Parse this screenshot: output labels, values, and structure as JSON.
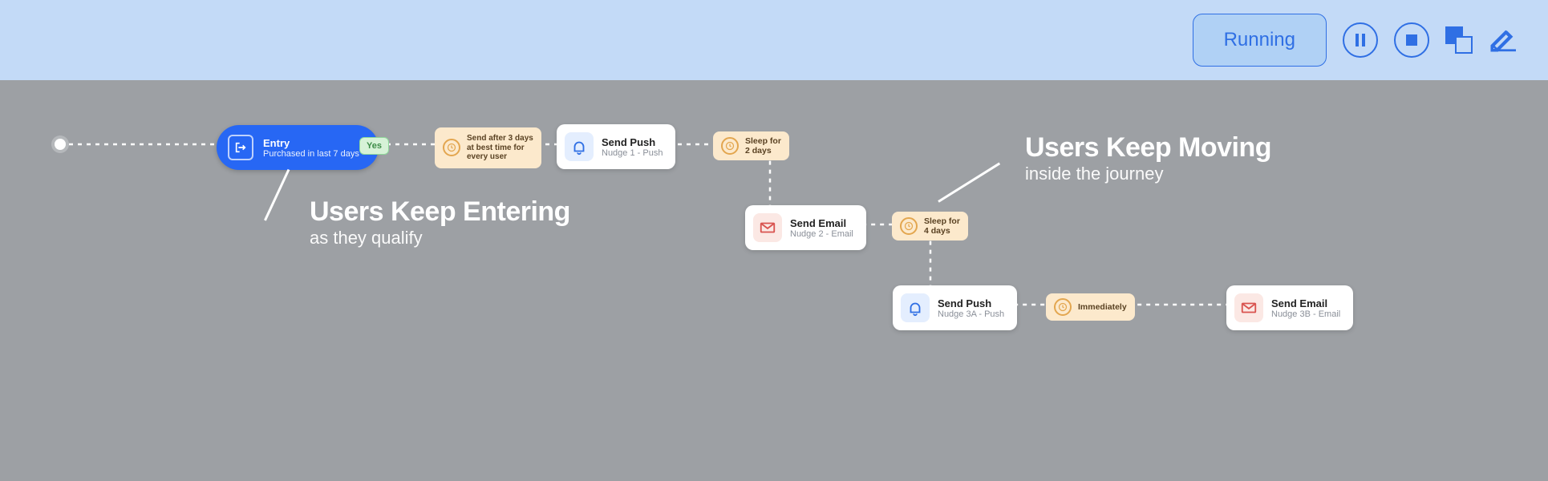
{
  "header": {
    "status": "Running"
  },
  "entry": {
    "title": "Entry",
    "subtitle": "Purchased in last 7 days"
  },
  "yes_label": "Yes",
  "wait1": "Send after 3 days\nat best time for\nevery user",
  "push1": {
    "title": "Send Push",
    "subtitle": "Nudge 1 - Push"
  },
  "sleep1": "Sleep for\n2 days",
  "email1": {
    "title": "Send Email",
    "subtitle": "Nudge 2 - Email"
  },
  "sleep2": "Sleep for\n4 days",
  "push2": {
    "title": "Send Push",
    "subtitle": "Nudge 3A - Push"
  },
  "immediately": "Immediately",
  "email2": {
    "title": "Send Email",
    "subtitle": "Nudge 3B - Email"
  },
  "anno_left": {
    "title": "Users Keep Entering",
    "sub": "as they qualify"
  },
  "anno_right": {
    "title": "Users Keep Moving",
    "sub": "inside the journey"
  }
}
